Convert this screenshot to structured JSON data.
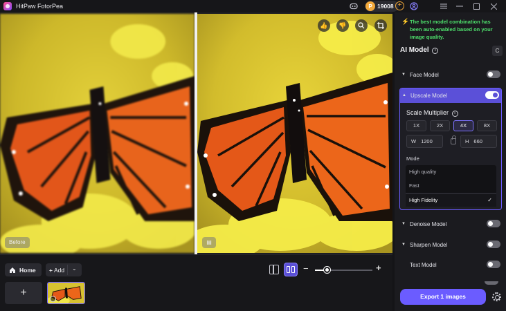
{
  "titlebar": {
    "title": "HitPaw FotorPea",
    "credits": "19008",
    "icons": [
      "app-logo-icon",
      "discord-icon",
      "coin-icon",
      "add-credits-icon",
      "user-icon",
      "menu-icon",
      "minimize-icon",
      "maximize-icon",
      "close-icon"
    ]
  },
  "canvas": {
    "before_label": "Before",
    "tools": [
      "like-icon",
      "dislike-icon",
      "zoom-in-icon",
      "crop-icon"
    ]
  },
  "bottom": {
    "home_label": "Home",
    "add_label": "Add",
    "add_tile_symbol": "+",
    "zoom_level": 0.2
  },
  "panel": {
    "notice": "The best model combination has been auto-enabled based on your image quality.",
    "ai_model_title": "AI Model",
    "reset_symbol": "C",
    "models": {
      "face": {
        "label": "Face Model",
        "enabled": false
      },
      "upscale": {
        "label": "Upscale Model",
        "enabled": true
      },
      "denoise": {
        "label": "Denoise Model",
        "enabled": false
      },
      "sharpen": {
        "label": "Sharpen Model",
        "enabled": false
      },
      "text": {
        "label": "Text Model",
        "enabled": false
      }
    },
    "scale_title": "Scale Multiplier",
    "multipliers": [
      "1X",
      "2X",
      "4X",
      "8X"
    ],
    "selected_multiplier": "4X",
    "width_label": "W",
    "width_value": "1200",
    "height_label": "H",
    "height_value": "660",
    "mode_label": "Mode",
    "modes": [
      "High quality",
      "Fast",
      "High Fidelity"
    ],
    "selected_mode": "High Fidelity",
    "export_label": "Export 1 images"
  },
  "colors": {
    "accent": "#6b5cff",
    "notice": "#4ee06c",
    "coin": "#f3a93b"
  }
}
